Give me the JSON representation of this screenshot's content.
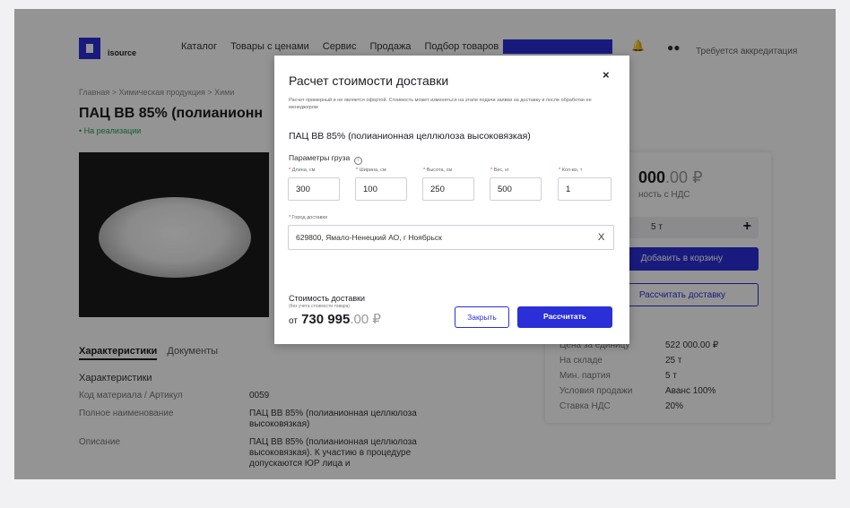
{
  "header": {
    "logo_text": "isource",
    "nav": [
      "Каталог",
      "Товары с ценами",
      "Сервис",
      "Продажа",
      "Подбор товаров"
    ],
    "user_status": "Требуется аккредитация"
  },
  "page": {
    "breadcrumb": "Главная > Химическая продукция > Хими",
    "title": "ПАЦ ВВ 85% (полианионн",
    "status": "• На реализации",
    "tabs": [
      "Характеристики",
      "Документы"
    ],
    "section_title": "Характеристики",
    "characteristics": [
      {
        "k": "Код материала / Артикул",
        "v": "0059"
      },
      {
        "k": "Полное наименование",
        "v": "ПАЦ ВВ 85% (полианионная целлюлоза высоковязкая)"
      },
      {
        "k": "Описание",
        "v": "ПАЦ ВВ 85% (полианионная целлюлоза высоковязкая). К участию в процедуре допускаются ЮР лица и"
      }
    ]
  },
  "card": {
    "price_main": "000",
    "price_frac": ".00 ₽",
    "price_sub": "ность с НДС",
    "qty": "5 т",
    "plus": "+",
    "add_to_cart": "Добавить в корзину",
    "calc_delivery": "Рассчитать доставку",
    "specs": [
      {
        "k": "Цена за единицу",
        "v": "522 000.00 ₽"
      },
      {
        "k": "На складе",
        "v": "25 т"
      },
      {
        "k": "Мин. партия",
        "v": "5 т"
      },
      {
        "k": "Условия продажи",
        "v": "Аванс 100%"
      },
      {
        "k": "Ставка НДС",
        "v": "20%"
      }
    ]
  },
  "modal": {
    "title": "Расчет стоимости доставки",
    "close": "×",
    "note": "Расчет примерный и не является офертой. Стоимость может изменяться на этапе подачи заявки на доставку и после обработки ее менеджером",
    "product_name": "ПАЦ ВВ 85% (полианионная целлюлоза высоковязкая)",
    "params_label": "Параметры груза",
    "info_icon": "i",
    "fields": {
      "length": {
        "label": "Длина, см",
        "value": "300"
      },
      "width": {
        "label": "Ширина, см",
        "value": "100"
      },
      "height": {
        "label": "Высота, см",
        "value": "250"
      },
      "weight": {
        "label": "Вес, кг",
        "value": "500"
      },
      "count": {
        "label": "Кол-во, т",
        "value": "1"
      }
    },
    "city_label": "Город доставки",
    "city_value": "629800, Ямало-Ненецкий АО, г Ноябрьск",
    "city_clear": "X",
    "cost_label": "Стоимость доставки",
    "cost_sub": "(без учета стоимости товара)",
    "cost_prefix": "от",
    "cost_main": "730 995",
    "cost_frac": ".00 ₽",
    "btn_close": "Закрыть",
    "btn_calc": "Рассчитать"
  }
}
